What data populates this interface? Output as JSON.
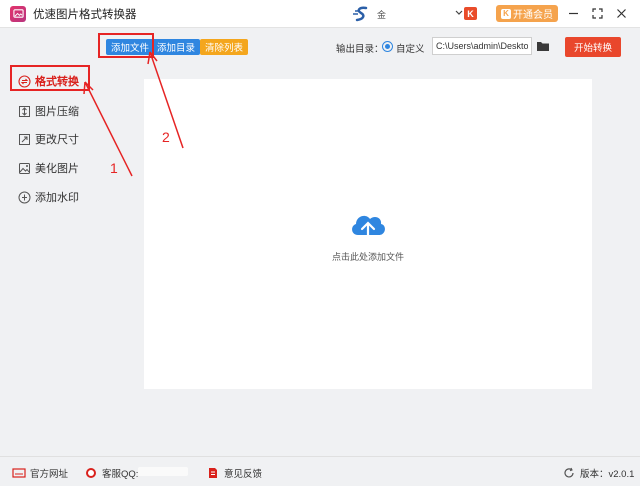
{
  "window": {
    "title": "优速图片格式转换器",
    "user_name": "金",
    "vip_label": "开通会员",
    "badge_k": "K",
    "vip_badge": "K"
  },
  "sidebar": {
    "items": [
      {
        "label": "格式转换",
        "icon": "convert-icon",
        "active": true
      },
      {
        "label": "图片压缩",
        "icon": "compress-icon"
      },
      {
        "label": "更改尺寸",
        "icon": "resize-icon"
      },
      {
        "label": "美化图片",
        "icon": "beautify-icon"
      },
      {
        "label": "添加水印",
        "icon": "watermark-icon"
      }
    ]
  },
  "toolbar": {
    "add_file": "添加文件",
    "add_dir": "添加目录",
    "clear_list": "清除列表",
    "output_label": "输出目录：",
    "custom_label": "自定义",
    "output_path": "C:\\Users\\admin\\Desktop",
    "start_label": "开始转换"
  },
  "content": {
    "drop_text": "点击此处添加文件"
  },
  "footer": {
    "website": "官方网址",
    "qq": "客服QQ:",
    "feedback": "意见反馈",
    "version": "版本：v2.0.1"
  },
  "annotations": {
    "num1": "1",
    "num2": "2"
  },
  "colors": {
    "accent_blue": "#2f86e0",
    "accent_orange": "#f4a61d",
    "start_red": "#e9472c",
    "annotation_red": "#e62424"
  }
}
